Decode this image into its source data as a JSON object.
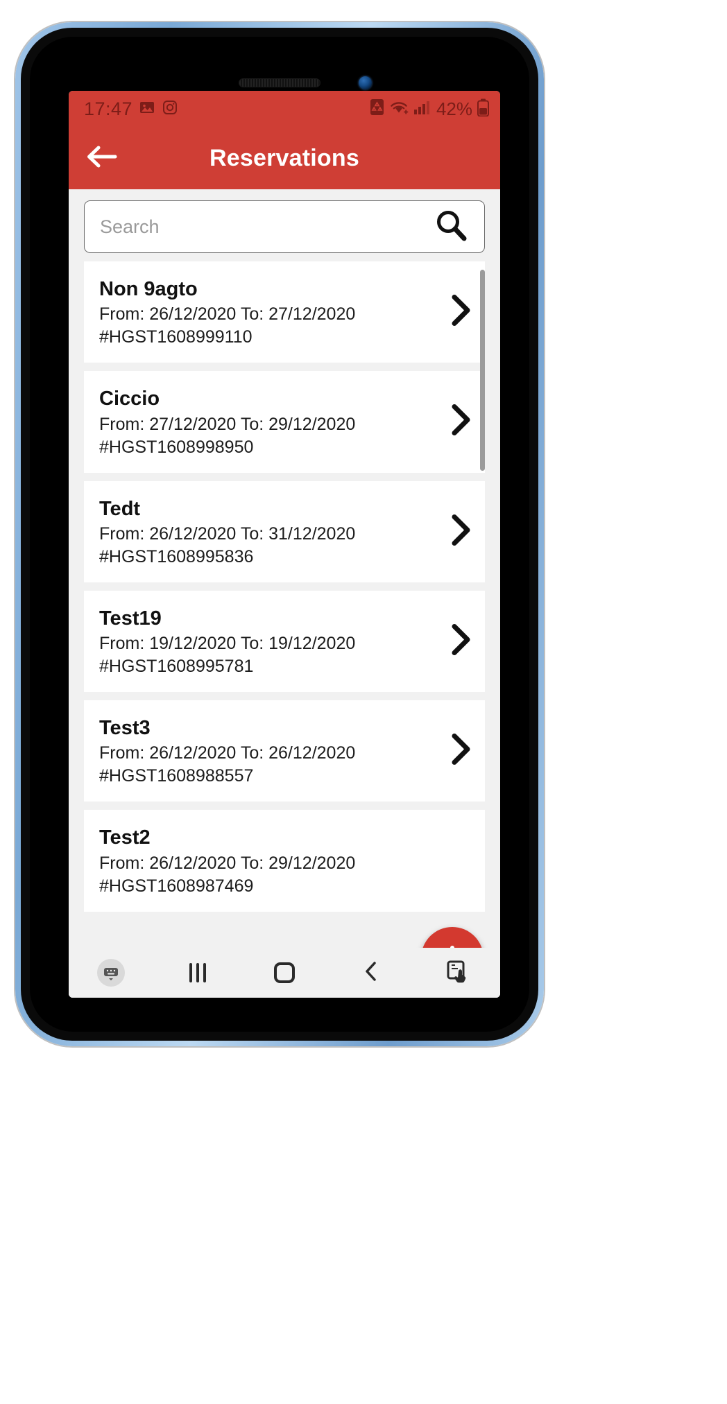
{
  "status_bar": {
    "time": "17:47",
    "left_icons": [
      "image-icon",
      "instagram-icon"
    ],
    "right_icons": [
      "alarm-recycle-icon",
      "wifi-icon",
      "signal-icon"
    ],
    "battery_percent": "42%"
  },
  "app_bar": {
    "back_icon": "arrow-left-icon",
    "title": "Reservations",
    "background_color": "#cf3e35"
  },
  "search": {
    "value": "",
    "placeholder": "Search",
    "icon": "search-icon"
  },
  "reservations": [
    {
      "name": "Non 9agto",
      "dates": "From: 26/12/2020  To: 27/12/2020",
      "code": "#HGST1608999110"
    },
    {
      "name": "Ciccio",
      "dates": "From: 27/12/2020  To: 29/12/2020",
      "code": "#HGST1608998950"
    },
    {
      "name": "Tedt",
      "dates": "From: 26/12/2020  To: 31/12/2020",
      "code": "#HGST1608995836"
    },
    {
      "name": "Test19",
      "dates": "From: 19/12/2020  To: 19/12/2020",
      "code": "#HGST1608995781"
    },
    {
      "name": "Test3",
      "dates": "From: 26/12/2020  To: 26/12/2020",
      "code": "#HGST1608988557"
    },
    {
      "name": "Test2",
      "dates": "From: 26/12/2020  To: 29/12/2020",
      "code": "#HGST1608987469"
    }
  ],
  "fab": {
    "icon": "plus-icon",
    "color": "#d3392f"
  },
  "nav_bar": {
    "items": [
      {
        "icon": "keyboard-hide-icon"
      },
      {
        "icon": "recents-icon"
      },
      {
        "icon": "home-icon"
      },
      {
        "icon": "back-icon"
      },
      {
        "icon": "screenshot-touch-icon"
      }
    ]
  },
  "theme": {
    "accent": "#cf3e35",
    "page_bg": "#f1f1f1",
    "card_bg": "#ffffff"
  }
}
